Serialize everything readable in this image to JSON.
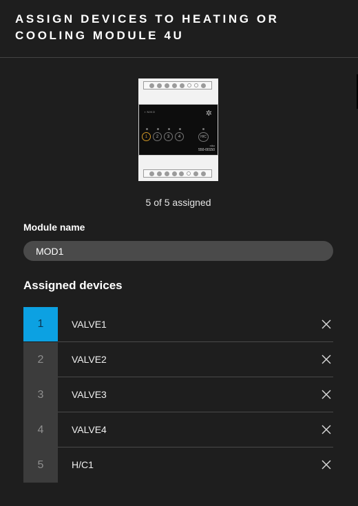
{
  "header": {
    "title": "ASSIGN DEVICES TO HEATING OR COOLING MODULE 4U"
  },
  "device_image": {
    "brand": "▪ NIKO",
    "channels": [
      "1",
      "2",
      "3",
      "4"
    ],
    "hc_label": "H/C",
    "maker": "niko",
    "model": "550-00150"
  },
  "status": {
    "assigned_text": "5 of 5 assigned"
  },
  "module": {
    "label": "Module name",
    "value": "MOD1"
  },
  "devices": {
    "label": "Assigned devices",
    "items": [
      {
        "number": "1",
        "name": "VALVE1",
        "selected": true
      },
      {
        "number": "2",
        "name": "VALVE2",
        "selected": false
      },
      {
        "number": "3",
        "name": "VALVE3",
        "selected": false
      },
      {
        "number": "4",
        "name": "VALVE4",
        "selected": false
      },
      {
        "number": "5",
        "name": "H/C1",
        "selected": false
      }
    ]
  },
  "colors": {
    "accent": "#0ca1e2",
    "background": "#1e1e1e",
    "channel_active": "#d59a26"
  },
  "icons": {
    "remove": "close-icon",
    "climate": "snowflake-sun-icon"
  }
}
